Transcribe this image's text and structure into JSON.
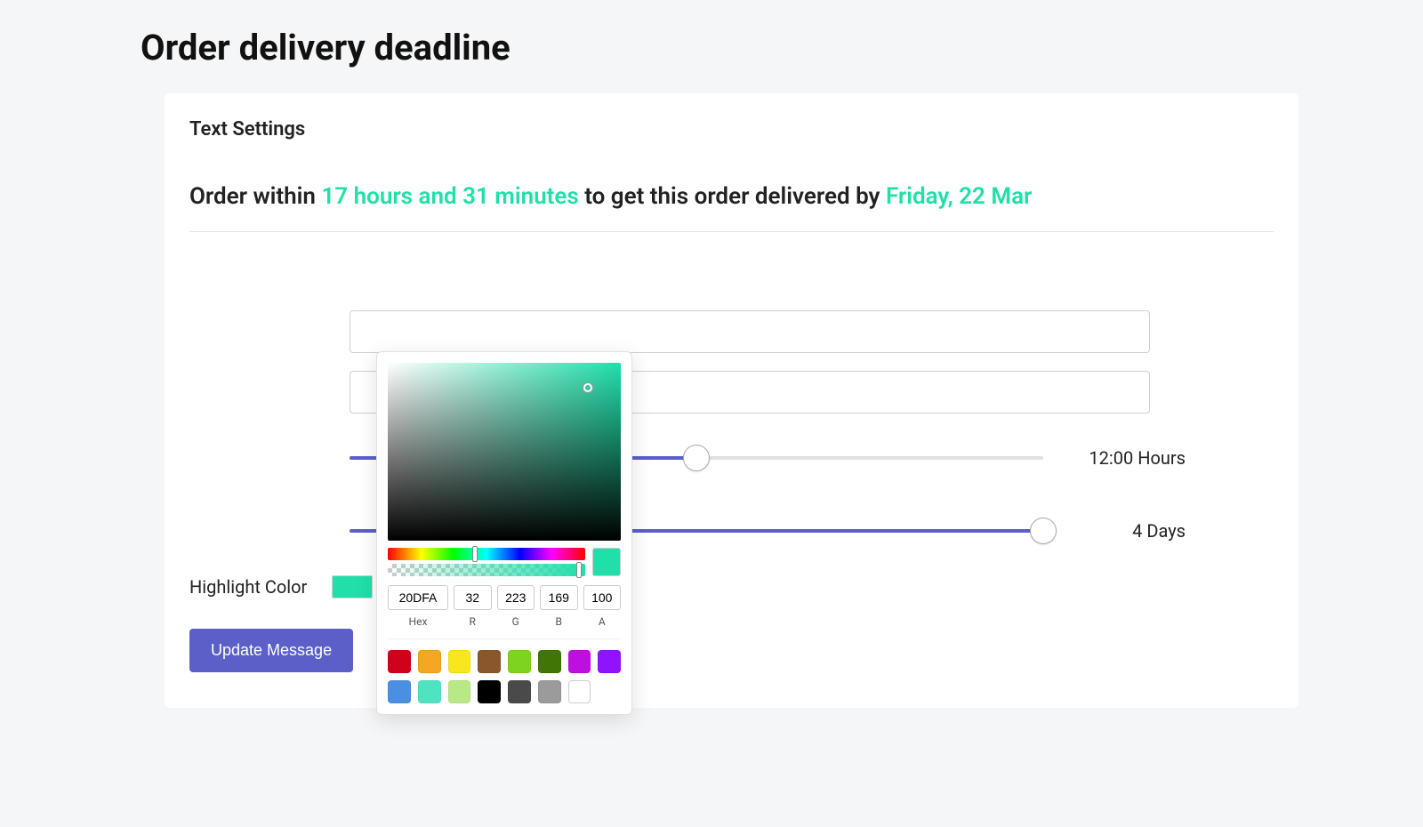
{
  "page": {
    "title": "Order delivery deadline"
  },
  "card": {
    "section_title": "Text Settings",
    "preview": {
      "prefix": "Order within ",
      "time_highlight": "17 hours and 31 minutes",
      "middle": " to get this order delivered by ",
      "date_highlight": "Friday, 22 Mar"
    },
    "fields": {
      "text1_value": "",
      "text2_value": ""
    },
    "sliders": {
      "hours": {
        "value_display": "12:00 Hours",
        "percent": 50
      },
      "days": {
        "value_display": "4 Days",
        "percent": 100
      }
    },
    "highlight": {
      "label": "Highlight Color",
      "color": "#20DFA9"
    },
    "button_label": "Update Message"
  },
  "color_picker": {
    "hex_value": "20DFA",
    "r_value": "32",
    "g_value": "223",
    "b_value": "169",
    "a_value": "100",
    "hex_label": "Hex",
    "r_label": "R",
    "g_label": "G",
    "b_label": "B",
    "a_label": "A",
    "sat_val_cursor": {
      "x_pct": 86,
      "y_pct": 14
    },
    "hue_thumb_pct": 44,
    "alpha_thumb_pct": 97,
    "presets": [
      "#D0021B",
      "#F5A623",
      "#F8E71C",
      "#8B572A",
      "#7ED321",
      "#417505",
      "#BD10E0",
      "#9013FE",
      "#4A90E2",
      "#50E3C2",
      "#B8E986",
      "#000000",
      "#4A4A4A",
      "#9B9B9B",
      "#FFFFFF"
    ]
  }
}
